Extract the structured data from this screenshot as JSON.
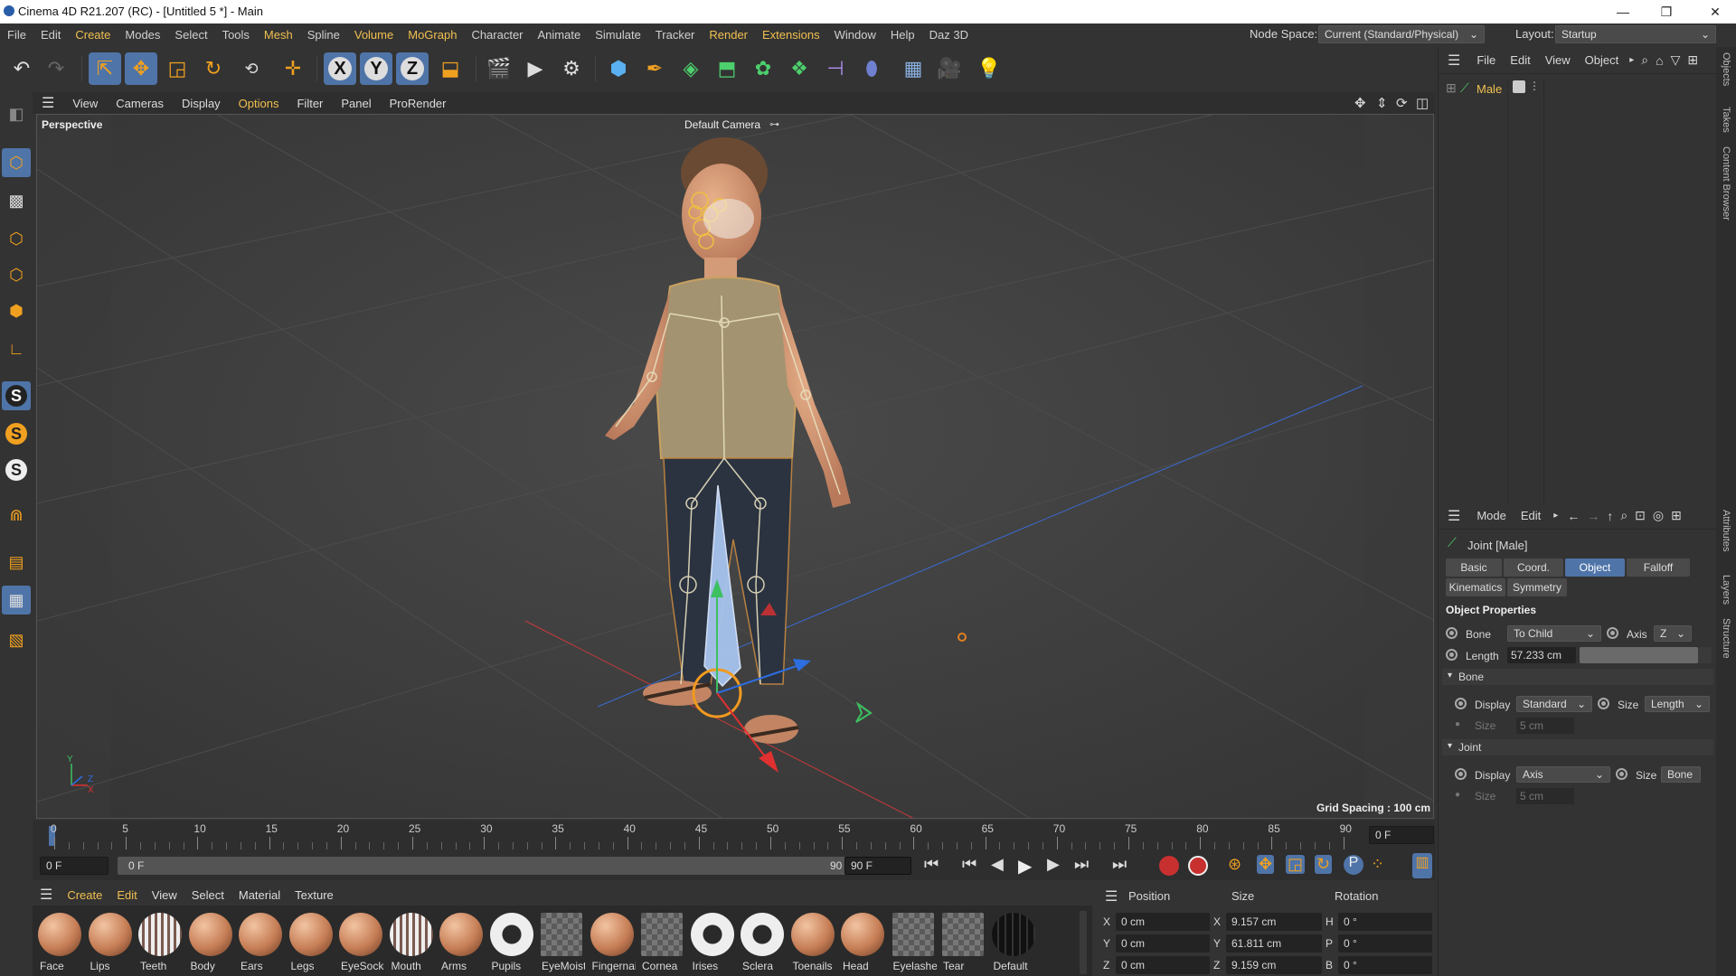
{
  "window": {
    "title": "Cinema 4D R21.207 (RC) - [Untitled 5 *] - Main",
    "min": "—",
    "max": "❐",
    "close": "✕"
  },
  "menu": {
    "items": [
      "File",
      "Edit",
      "Create",
      "Modes",
      "Select",
      "Tools",
      "Mesh",
      "Spline",
      "Volume",
      "MoGraph",
      "Character",
      "Animate",
      "Simulate",
      "Tracker",
      "Render",
      "Extensions",
      "Window",
      "Help",
      "Daz 3D"
    ],
    "node_space_label": "Node Space:",
    "node_space_value": "Current (Standard/Physical)",
    "layout_label": "Layout:",
    "layout_value": "Startup"
  },
  "toolbar": {
    "xyz": [
      "X",
      "Y",
      "Z"
    ]
  },
  "viewport": {
    "menu": [
      "View",
      "Cameras",
      "Display",
      "Options",
      "Filter",
      "Panel",
      "ProRender"
    ],
    "label": "Perspective",
    "camera": "Default Camera",
    "grid": "Grid Spacing : 100 cm",
    "axis_y": "Y",
    "axis_z": "Z",
    "axis_x": "X"
  },
  "timeline": {
    "ticks": [
      "0",
      "5",
      "10",
      "15",
      "20",
      "25",
      "30",
      "35",
      "40",
      "45",
      "50",
      "55",
      "60",
      "65",
      "70",
      "75",
      "80",
      "85",
      "90"
    ],
    "current_frame": "0 F",
    "start_frame": "0 F",
    "range_start": "0 F",
    "range_end": "90 F",
    "end_frame": "90 F"
  },
  "materials": {
    "menu": [
      "Create",
      "Edit",
      "View",
      "Select",
      "Material",
      "Texture"
    ],
    "items": [
      {
        "name": "Face",
        "type": "skin"
      },
      {
        "name": "Lips",
        "type": "skin"
      },
      {
        "name": "Teeth",
        "type": "stripe"
      },
      {
        "name": "Body",
        "type": "skin"
      },
      {
        "name": "Ears",
        "type": "skin"
      },
      {
        "name": "Legs",
        "type": "skin"
      },
      {
        "name": "EyeSocket",
        "type": "skin"
      },
      {
        "name": "Mouth",
        "type": "stripe"
      },
      {
        "name": "Arms",
        "type": "skin"
      },
      {
        "name": "Pupils",
        "type": "star"
      },
      {
        "name": "EyeMoisture",
        "type": "checker"
      },
      {
        "name": "Fingernails",
        "type": "skin"
      },
      {
        "name": "Cornea",
        "type": "checker"
      },
      {
        "name": "Irises",
        "type": "star"
      },
      {
        "name": "Sclera",
        "type": "star"
      },
      {
        "name": "Toenails",
        "type": "skin"
      },
      {
        "name": "Head",
        "type": "skin"
      },
      {
        "name": "Eyelashes",
        "type": "checker"
      },
      {
        "name": "Tear",
        "type": "checker"
      },
      {
        "name": "Default",
        "type": "dark"
      }
    ]
  },
  "coords": {
    "headers": [
      "Position",
      "Size",
      "Rotation"
    ],
    "rows": [
      {
        "axis": "X",
        "pos": "0 cm",
        "saxis": "X",
        "size": "9.157 cm",
        "raxis": "H",
        "rot": "0 °"
      },
      {
        "axis": "Y",
        "pos": "0 cm",
        "saxis": "Y",
        "size": "61.811 cm",
        "raxis": "P",
        "rot": "0 °"
      },
      {
        "axis": "Z",
        "pos": "0 cm",
        "saxis": "Z",
        "size": "9.159 cm",
        "raxis": "B",
        "rot": "0 °"
      }
    ]
  },
  "objects": {
    "menu": [
      "File",
      "Edit",
      "View",
      "Object"
    ],
    "item": "Male"
  },
  "attributes": {
    "menu": [
      "Mode",
      "Edit"
    ],
    "title": "Joint [Male]",
    "tabs": [
      "Basic",
      "Coord.",
      "Object",
      "Falloff",
      "Kinematics",
      "Symmetry"
    ],
    "active_tab": "Object",
    "section": "Object Properties",
    "bone_label": "Bone",
    "bone_value": "To Child",
    "axis_label": "Axis",
    "axis_value": "Z",
    "length_label": "Length",
    "length_value": "57.233 cm",
    "length_fraction": 0.9,
    "bone_group": "Bone",
    "bone_display_label": "Display",
    "bone_display_value": "Standard",
    "bone_size_label": "Size",
    "bone_size_value": "Length",
    "bone_size2_label": "Size",
    "bone_size2_value": "5 cm",
    "joint_group": "Joint",
    "joint_display_label": "Display",
    "joint_display_value": "Axis",
    "joint_size_label": "Size",
    "joint_size_value": "Bone",
    "joint_size2_label": "Size",
    "joint_size2_value": "5 cm"
  },
  "side_tabs": {
    "top": [
      "Objects",
      "Takes",
      "Content Browser"
    ],
    "bottom": [
      "Attributes",
      "Layers",
      "Structure"
    ]
  }
}
